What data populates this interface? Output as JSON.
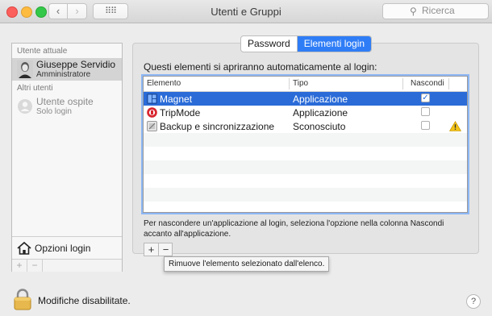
{
  "window": {
    "title": "Utenti e Gruppi"
  },
  "toolbar": {
    "back_icon": "chevron-left-icon",
    "forward_icon": "chevron-right-icon",
    "grid_icon": "grid-icon"
  },
  "search": {
    "placeholder": "Ricerca",
    "value": ""
  },
  "sidebar": {
    "current_user_header": "Utente attuale",
    "current_user": {
      "name": "Giuseppe Servidio",
      "role": "Amministratore"
    },
    "other_users_header": "Altri utenti",
    "other_users": [
      {
        "name": "Utente ospite",
        "role": "Solo login"
      }
    ],
    "login_options_label": "Opzioni login",
    "add_label": "+",
    "remove_label": "−"
  },
  "tabs": [
    {
      "label": "Password",
      "active": false
    },
    {
      "label": "Elementi login",
      "active": true
    }
  ],
  "main": {
    "heading": "Questi elementi si apriranno automaticamente al login:",
    "columns": [
      "Elemento",
      "Tipo",
      "Nascondi"
    ],
    "rows": [
      {
        "name": "Magnet",
        "type": "Applicazione",
        "hidden": true,
        "selected": true,
        "icon": "magnet-app-icon",
        "warning": false
      },
      {
        "name": "TripMode",
        "type": "Applicazione",
        "hidden": false,
        "selected": false,
        "icon": "tripmode-app-icon",
        "warning": false
      },
      {
        "name": "Backup e sincronizzazione",
        "type": "Sconosciuto",
        "hidden": false,
        "selected": false,
        "icon": "generic-app-icon",
        "warning": true
      }
    ],
    "note": "Per nascondere un'applicazione al login, seleziona l'opzione nella colonna Nascondi accanto all'applicazione.",
    "add_label": "+",
    "remove_label": "−",
    "tooltip": "Rimuove l'elemento selezionato dall'elenco."
  },
  "footer": {
    "lock_text": "Modifiche disabilitate.",
    "help_label": "?"
  },
  "colors": {
    "accent": "#2f7df6",
    "selection": "#2a6bd8",
    "warning": "#f5c518"
  }
}
